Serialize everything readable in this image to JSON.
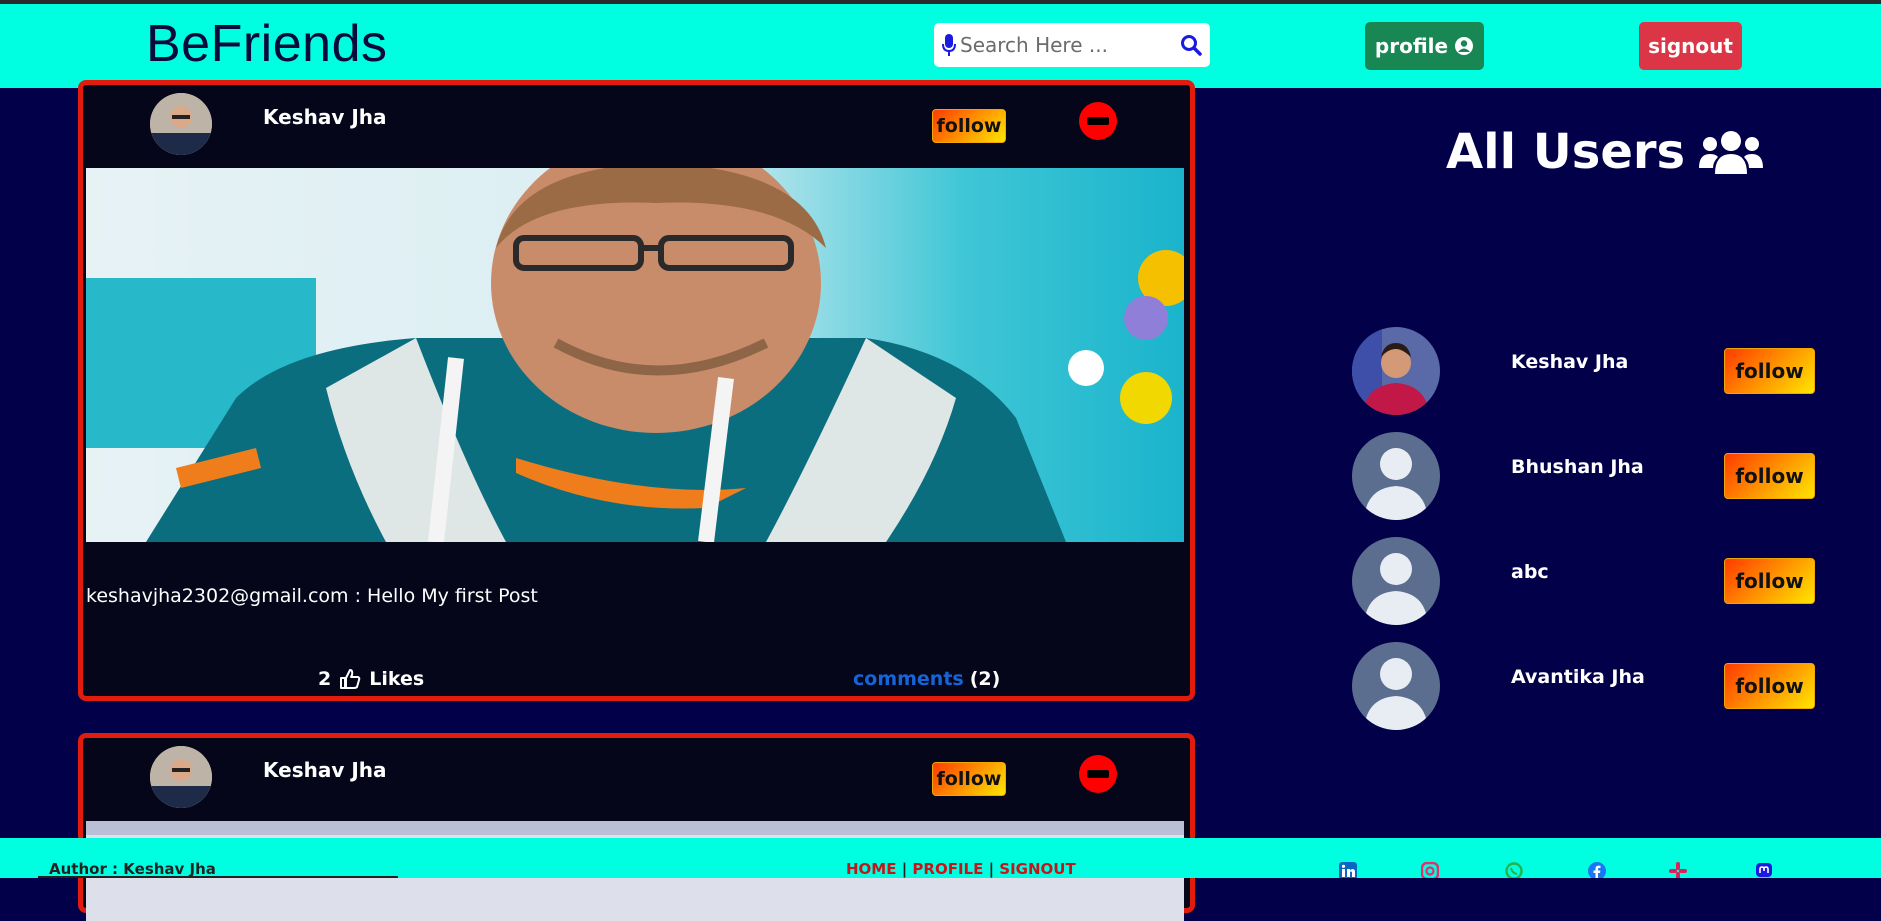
{
  "navbar": {
    "brand": "BeFriends",
    "search_placeholder": "Search Here ...",
    "profile_label": "profile",
    "signout_label": "signout"
  },
  "posts": [
    {
      "author": "Keshav Jha",
      "follow_label": "follow",
      "caption": "keshavjha2302@gmail.com : Hello My first Post",
      "likes_count": "2",
      "likes_label": "Likes",
      "comments_label": "comments",
      "comments_count": "(2)"
    },
    {
      "author": "Keshav Jha",
      "follow_label": "follow"
    }
  ],
  "all_users": {
    "title": "All Users",
    "users": [
      {
        "name": "Keshav Jha",
        "follow_label": "follow",
        "avatar": "photo"
      },
      {
        "name": "Bhushan Jha",
        "follow_label": "follow",
        "avatar": "default-avatar"
      },
      {
        "name": "abc",
        "follow_label": "follow",
        "avatar": "default-avatar"
      },
      {
        "name": "Avantika Jha",
        "follow_label": "follow",
        "avatar": "default-avatar"
      }
    ]
  },
  "footer": {
    "author": "Author : Keshav Jha",
    "links": [
      "HOME",
      "PROFILE",
      "SIGNOUT"
    ],
    "socials": [
      "linkedin-icon",
      "instagram-icon",
      "whatsapp-icon",
      "facebook-icon",
      "slack-icon",
      "mastodon-icon"
    ]
  },
  "colors": {
    "navbar_bg": "#00ffe1",
    "page_bg": "#03004a",
    "post_border": "#e11b0e",
    "profile_btn": "#198754",
    "signout_btn": "#dc3545",
    "comments_link": "#1565d8",
    "footer_link": "#c7141b"
  }
}
